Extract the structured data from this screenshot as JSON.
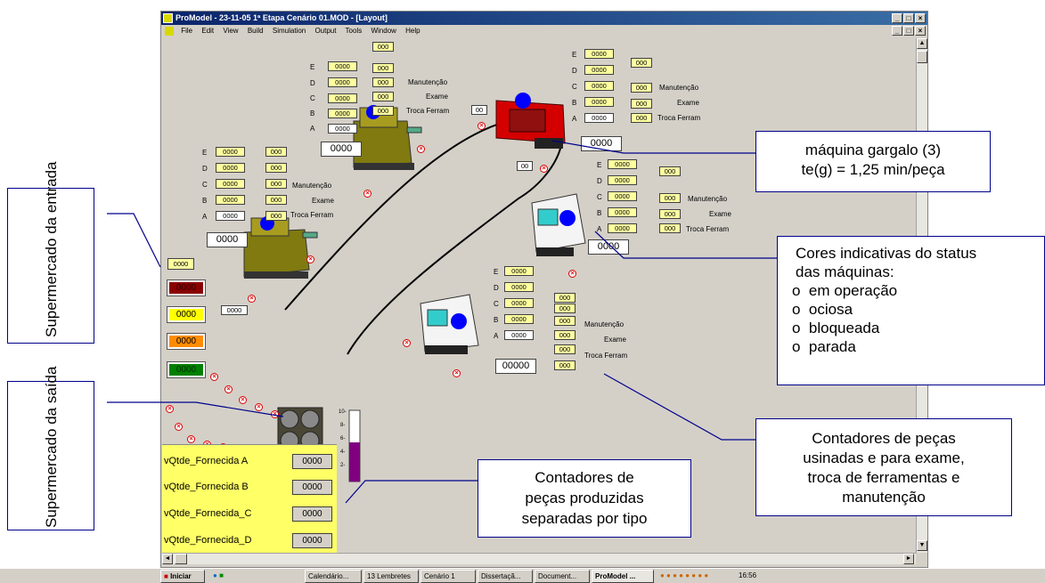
{
  "window": {
    "title": "ProModel - 23-11-05 1ª Etapa Cenário 01.MOD - [Layout]"
  },
  "menu": [
    "File",
    "Edit",
    "View",
    "Build",
    "Simulation",
    "Output",
    "Tools",
    "Window",
    "Help"
  ],
  "labels": {
    "manut": "Manutenção",
    "exame": "Exame",
    "troca": "Troca Ferram",
    "E": "E",
    "D": "D",
    "C": "C",
    "B": "B",
    "A": "A"
  },
  "cells": {
    "c1": {
      "parts": [
        "0000",
        "0000",
        "0000",
        "0000",
        "0000"
      ],
      "counters": [
        "000",
        "000",
        "000",
        "000",
        "000"
      ],
      "total": "0000",
      "queue": "00"
    },
    "c2": {
      "parts": [
        "0000",
        "0000",
        "0000",
        "0000",
        "0000"
      ],
      "counters": [
        "000",
        "000",
        "000",
        "000",
        "000"
      ],
      "total": "0000"
    },
    "c3": {
      "parts": [
        "0000",
        "0000",
        "0000",
        "0000",
        "0000"
      ],
      "counters": [
        "000",
        "000",
        "000",
        "000"
      ],
      "total": "0000",
      "queue": "00"
    },
    "c4": {
      "parts": [
        "0000",
        "0000",
        "0000",
        "0000",
        "0000"
      ],
      "counters": [
        "000",
        "000",
        "000",
        "000"
      ],
      "total": "0000"
    },
    "c5": {
      "parts": [
        "0000",
        "0000",
        "0000",
        "0000",
        "0000"
      ],
      "counters": [
        "000",
        "000",
        "000",
        "000",
        "000",
        "000"
      ],
      "total": "00000"
    }
  },
  "status": {
    "yellow_top": "0000",
    "red": "0000",
    "yellow": "0000",
    "orange": "0000",
    "green": "0000",
    "input": "0000"
  },
  "gauge": {
    "ticks": [
      "10-",
      "8-",
      "6-",
      "4-",
      "2-"
    ],
    "fill_fraction": 0.55
  },
  "supply": {
    "rows": [
      {
        "label": "vQtde_Fornecida A",
        "value": "0000"
      },
      {
        "label": "vQtde_Fornecida B",
        "value": "0000"
      },
      {
        "label": "vQtde_Fornecida_C",
        "value": "0000"
      },
      {
        "label": "vQtde_Fornecida_D",
        "value": "0000"
      }
    ]
  },
  "callouts": {
    "entrada": "Supermercado da entrada",
    "saida": "Supermercado da saída",
    "gargalo_l1": "máquina gargalo (3)",
    "gargalo_l2": "te(g) = 1,25 min/peça",
    "cores_title_l1": "Cores indicativas do status",
    "cores_title_l2": "das máquinas:",
    "cores_items": [
      "em operação",
      "ociosa",
      "bloqueada",
      "parada"
    ],
    "usinadas_l1": "Contadores de peças",
    "usinadas_l2": "usinadas e para exame,",
    "usinadas_l3": "troca de ferramentas e",
    "usinadas_l4": "manutenção",
    "produzidas_l1": "Contadores de",
    "produzidas_l2": "peças produzidas",
    "produzidas_l3": "separadas por tipo"
  },
  "taskbar": {
    "start": "Iniciar",
    "items": [
      "Calendário...",
      "13 Lembretes",
      "Cenário 1",
      "Dissertaçã...",
      "Document...",
      "ProModel ..."
    ],
    "clock": "16:56"
  },
  "colors": {
    "title": "#0a246a",
    "red": "#8b0000",
    "yellow": "#ffff00",
    "orange": "#ff8c00",
    "green": "#008000",
    "gauge": "#800080",
    "callout_border": "#00008b"
  }
}
